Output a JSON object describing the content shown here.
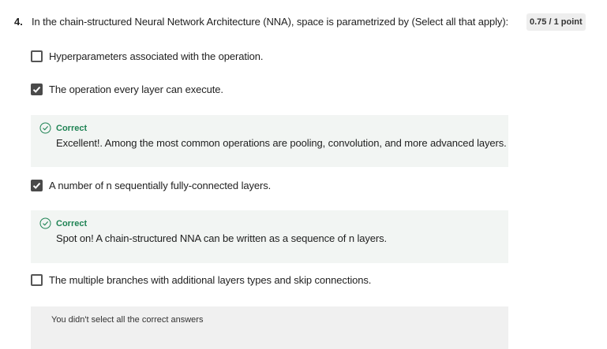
{
  "question": {
    "number": "4.",
    "text": "In the chain-structured Neural Network Architecture (NNA), space is parametrized by (Select all that apply):",
    "score": "0.75 / 1 point"
  },
  "options": [
    {
      "label": "Hyperparameters associated with the operation.",
      "checked": false
    },
    {
      "label": "The operation every layer can execute.",
      "checked": true
    },
    {
      "label": "A number of n sequentially fully-connected layers.",
      "checked": true
    },
    {
      "label": "The multiple branches with additional layers types and skip connections.",
      "checked": false
    }
  ],
  "feedback": [
    {
      "status": "Correct",
      "message": "Excellent!. Among the most common operations are pooling, convolution, and more advanced layers."
    },
    {
      "status": "Correct",
      "message": "Spot on! A chain-structured NNA can be written as a sequence of n layers."
    }
  ],
  "summary": {
    "text": "You didn't select all the correct answers"
  },
  "colors": {
    "correct": "#1f8354",
    "feedback_bg": "#f2f5f3",
    "summary_bg": "#f0f0f0",
    "checkbox_checked": "#4a4a4a"
  },
  "icons": {
    "check": "checkmark-icon",
    "correct": "check-circle-icon"
  }
}
